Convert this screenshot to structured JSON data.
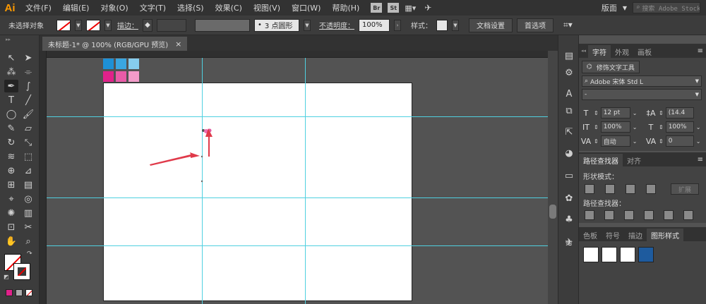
{
  "menubar": {
    "logo": "Ai",
    "items": [
      "文件(F)",
      "编辑(E)",
      "对象(O)",
      "文字(T)",
      "选择(S)",
      "效果(C)",
      "视图(V)",
      "窗口(W)",
      "帮助(H)"
    ],
    "bridge": "Br",
    "stock": "St",
    "workspace": "版面",
    "search_placeholder": "搜索 Adobe Stock"
  },
  "control_bar": {
    "selection_status": "未选择对象",
    "stroke_label": "描边：",
    "brush_value": "3 点圆形",
    "opacity_label": "不透明度：",
    "opacity_value": "100%",
    "style_label": "样式：",
    "doc_setup_button": "文档设置",
    "preferences_button": "首选项"
  },
  "document": {
    "tab_title": "未标题-1* @ 100% (RGB/GPU 预览)",
    "close": "×"
  },
  "swatch_colors": {
    "top_row": [
      "#1e90d6",
      "#3aa6e0",
      "#86cdee"
    ],
    "bottom_row": [
      "#e0218a",
      "#e95ba8",
      "#f29bc9"
    ]
  },
  "guide_color": "#4fd0e0",
  "arrow_color": "#e03a4a",
  "character_panel": {
    "tabs": [
      "字符",
      "外观",
      "画板"
    ],
    "touch_type_button": "修饰文字工具",
    "font_family": "Adobe 宋体 Std L",
    "font_style": "-",
    "font_size": "12 pt",
    "leading": "(14.4",
    "vertical_scale": "100%",
    "horizontal_scale": "100%",
    "kerning": "自动",
    "tracking": "0"
  },
  "pathfinder_panel": {
    "tabs": [
      "路径查找器",
      "对齐"
    ],
    "shape_modes_label": "形状模式：",
    "expand_button": "扩展",
    "pathfinders_label": "路径查找器："
  },
  "graphic_styles_panel": {
    "tabs": [
      "色板",
      "符号",
      "描边",
      "图形样式"
    ]
  }
}
